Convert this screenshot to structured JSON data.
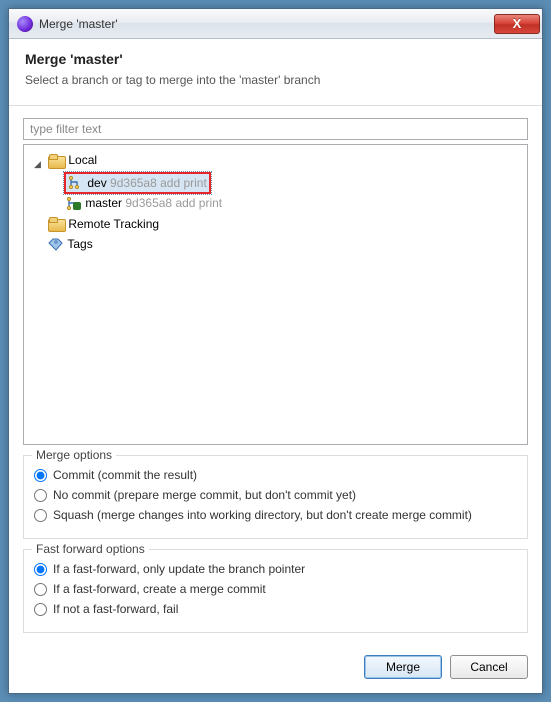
{
  "window": {
    "title": "Merge 'master'"
  },
  "header": {
    "title": "Merge 'master'",
    "subtitle": "Select a branch or tag to merge into the 'master' branch"
  },
  "filter": {
    "placeholder": "type filter text",
    "value": ""
  },
  "tree": {
    "local_label": "Local",
    "dev": {
      "name": "dev",
      "hash": "9d365a8",
      "msg": "add print"
    },
    "master": {
      "name": "master",
      "hash": "9d365a8",
      "msg": "add print"
    },
    "remote_label": "Remote Tracking",
    "tags_label": "Tags"
  },
  "merge_options": {
    "legend": "Merge options",
    "commit": "Commit (commit the result)",
    "no_commit": "No commit (prepare merge commit, but don't commit yet)",
    "squash": "Squash (merge changes into working directory, but don't create merge commit)"
  },
  "ff_options": {
    "legend": "Fast forward options",
    "ff_only_update": "If a fast-forward, only update the branch pointer",
    "ff_create_merge": "If a fast-forward, create a merge commit",
    "not_ff_fail": "If not a fast-forward, fail"
  },
  "buttons": {
    "merge": "Merge",
    "cancel": "Cancel"
  }
}
